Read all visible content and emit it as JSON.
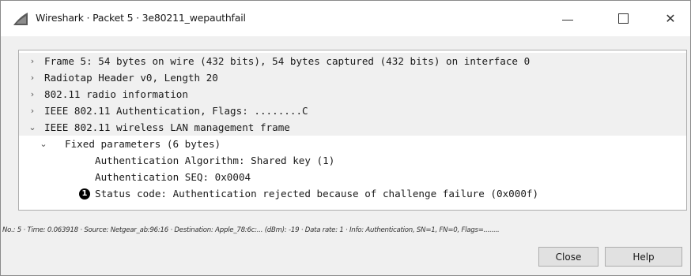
{
  "window": {
    "title": "Wireshark · Packet 5 · 3e80211_wepauthfail",
    "icon": "wireshark-fin-icon",
    "controls": {
      "minimize_icon": "minimize-icon",
      "maximize_icon": "maximize-icon",
      "close_label": "✕"
    }
  },
  "tree": {
    "rows": [
      {
        "text": "Frame 5: 54 bytes on wire (432 bits), 54 bytes captured (432 bits) on interface 0",
        "expander": "›",
        "indent": 0
      },
      {
        "text": "Radiotap Header v0, Length 20",
        "expander": "›",
        "indent": 0
      },
      {
        "text": "802.11 radio information",
        "expander": "›",
        "indent": 0
      },
      {
        "text": "IEEE 802.11 Authentication, Flags: ........C",
        "expander": "›",
        "indent": 0
      },
      {
        "text": "IEEE 802.11 wireless LAN management frame",
        "expander": "⌄",
        "indent": 0
      },
      {
        "text": "Fixed parameters (6 bytes)",
        "expander": "⌄",
        "indent": 1
      },
      {
        "text": "Authentication Algorithm: Shared key (1)",
        "expander": "",
        "indent": 2
      },
      {
        "text": "Authentication SEQ: 0x0004",
        "expander": "",
        "indent": 2
      },
      {
        "text": "Status code: Authentication rejected because of challenge failure (0x000f)",
        "expander": "",
        "indent": 2,
        "marker": "1"
      }
    ]
  },
  "status_line": "No.: 5 · Time: 0.063918 · Source: Netgear_ab:96:16 · Destination: Apple_78:6c:... (dBm): -19 · Data rate: 1 · Info: Authentication, SN=1, FN=0, Flags=........",
  "buttons": {
    "close": "Close",
    "help": "Help"
  },
  "colors": {
    "shaded_row": "#f0f0f0",
    "panel_border": "#adadad",
    "button_face": "#e1e1e1"
  }
}
